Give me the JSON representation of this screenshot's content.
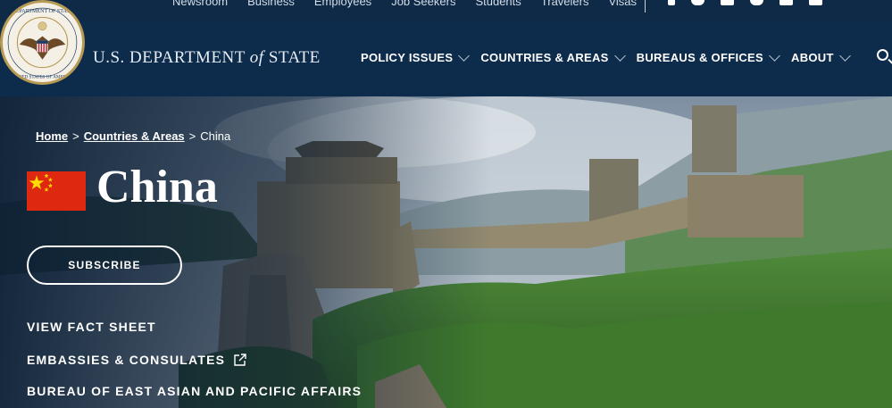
{
  "utility": {
    "links": [
      "Newsroom",
      "Business",
      "Employees",
      "Job Seekers",
      "Students",
      "Travelers",
      "Visas"
    ],
    "social_icons": [
      "facebook-icon",
      "twitter-icon",
      "instagram-icon",
      "youtube-icon",
      "flickr-icon",
      "linkedin-icon"
    ]
  },
  "header": {
    "agency_prefix": "U.S. DEPARTMENT ",
    "agency_of": "of",
    "agency_suffix": " STATE",
    "seal_text": "DEPARTMENT OF STATE · UNITED STATES OF AMERICA",
    "nav": [
      {
        "label": "POLICY ISSUES"
      },
      {
        "label": "COUNTRIES & AREAS"
      },
      {
        "label": "BUREAUS & OFFICES"
      },
      {
        "label": "ABOUT"
      }
    ],
    "search_icon": "search-icon"
  },
  "hero": {
    "breadcrumb": {
      "home": "Home",
      "sep": ">",
      "countries": "Countries & Areas",
      "current": "China"
    },
    "title": "China",
    "flag_icon": "china-flag",
    "subscribe_label": "SUBSCRIBE",
    "links": {
      "fact_sheet": "VIEW FACT SHEET",
      "embassies": "EMBASSIES & CONSULATES",
      "bureau": "BUREAU OF EAST ASIAN AND PACIFIC AFFAIRS"
    }
  },
  "colors": {
    "header_bg": "#0d2b4b",
    "utility_bg": "#0e2a47",
    "flag_red": "#de2910",
    "flag_yellow": "#ffde00"
  }
}
